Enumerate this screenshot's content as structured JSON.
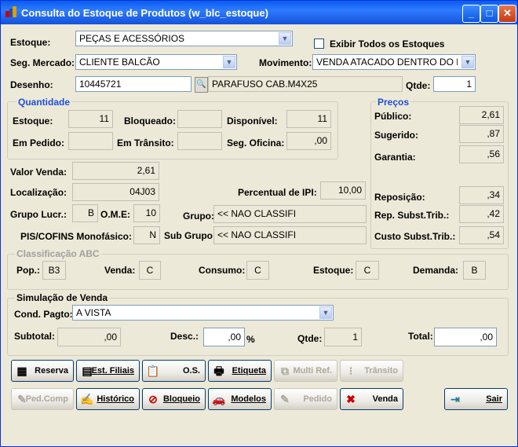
{
  "window": {
    "title": "Consulta do Estoque de Produtos (w_blc_estoque)"
  },
  "labels": {
    "estoque": "Estoque:",
    "exibir_todos": "Exibir Todos os Estoques",
    "seg_mercado": "Seg. Mercado:",
    "movimento": "Movimento:",
    "desenho": "Desenho:",
    "qtde": "Qtde:",
    "quantidade": "Quantidade",
    "precos": "Preços",
    "q_estoque": "Estoque:",
    "bloqueado": "Bloqueado:",
    "disponivel": "Disponível:",
    "em_pedido": "Em Pedido:",
    "em_transito": "Em Trânsito:",
    "seg_oficina": "Seg. Oficina:",
    "publico": "Público:",
    "sugerido": "Sugerido:",
    "garantia": "Garantia:",
    "valor_venda": "Valor Venda:",
    "localizacao": "Localização:",
    "percentual_ipi": "Percentual de IPI:",
    "reposicao": "Reposição:",
    "grupo_lucr": "Grupo Lucr.:",
    "ome": "O.M.E:",
    "grupo": "Grupo:",
    "rep_subst": "Rep. Subst.Trib.:",
    "pis_cofins": "PIS/COFINS Monofásico:",
    "sub_grupo": "Sub Grupo:",
    "custo_subst": "Custo Subst.Trib.:",
    "classificacao_abc": "Classificação ABC",
    "pop": "Pop.:",
    "venda": "Venda:",
    "consumo": "Consumo:",
    "abc_estoque": "Estoque:",
    "demanda": "Demanda:",
    "simulacao": "Simulação de Venda",
    "cond_pagto": "Cond. Pagto:",
    "subtotal": "Subtotal:",
    "desc": "Desc.:",
    "pct": "%",
    "sim_qtde": "Qtde:",
    "total": "Total:"
  },
  "values": {
    "estoque": "PEÇAS E ACESSÓRIOS",
    "seg_mercado": "CLIENTE BALCÃO",
    "movimento": "VENDA ATACADO DENTRO DO E",
    "desenho": "10445721",
    "descricao": "PARAFUSO CAB.M4X25",
    "qtde": "1",
    "q_estoque": "11",
    "bloqueado": "",
    "disponivel": "11",
    "em_pedido": "",
    "em_transito": "",
    "seg_oficina": ",00",
    "publico": "2,61",
    "sugerido": ",87",
    "garantia": ",56",
    "valor_venda": "2,61",
    "localizacao": "04J03",
    "percentual_ipi": "10,00",
    "reposicao": ",34",
    "grupo_lucr": "B",
    "ome": "10",
    "grupo": "<< NAO CLASSIFI",
    "rep_subst": ",42",
    "pis_cofins": "N",
    "sub_grupo": "<< NAO CLASSIFI",
    "custo_subst": ",54",
    "pop": "B3",
    "venda": "C",
    "consumo": "C",
    "abc_estoque": "C",
    "demanda": "B",
    "cond_pagto": "A VISTA",
    "subtotal": ",00",
    "desc": ",00",
    "sim_qtde": "1",
    "total": ",00"
  },
  "buttons": {
    "reserva": "Reserva",
    "est_filiais": "Est. Filiais",
    "os": "O.S.",
    "etiqueta": "Etiqueta",
    "multi_ref": "Multi Ref.",
    "transito": "Trânsito",
    "ped_comp": "Ped.Comp",
    "historico": "Histórico",
    "bloqueio": "Bloqueio",
    "modelos": "Modelos",
    "pedido": "Pedido",
    "venda": "Venda",
    "sair": "Sair"
  },
  "checkbox": {
    "exibir_todos_checked": false
  }
}
